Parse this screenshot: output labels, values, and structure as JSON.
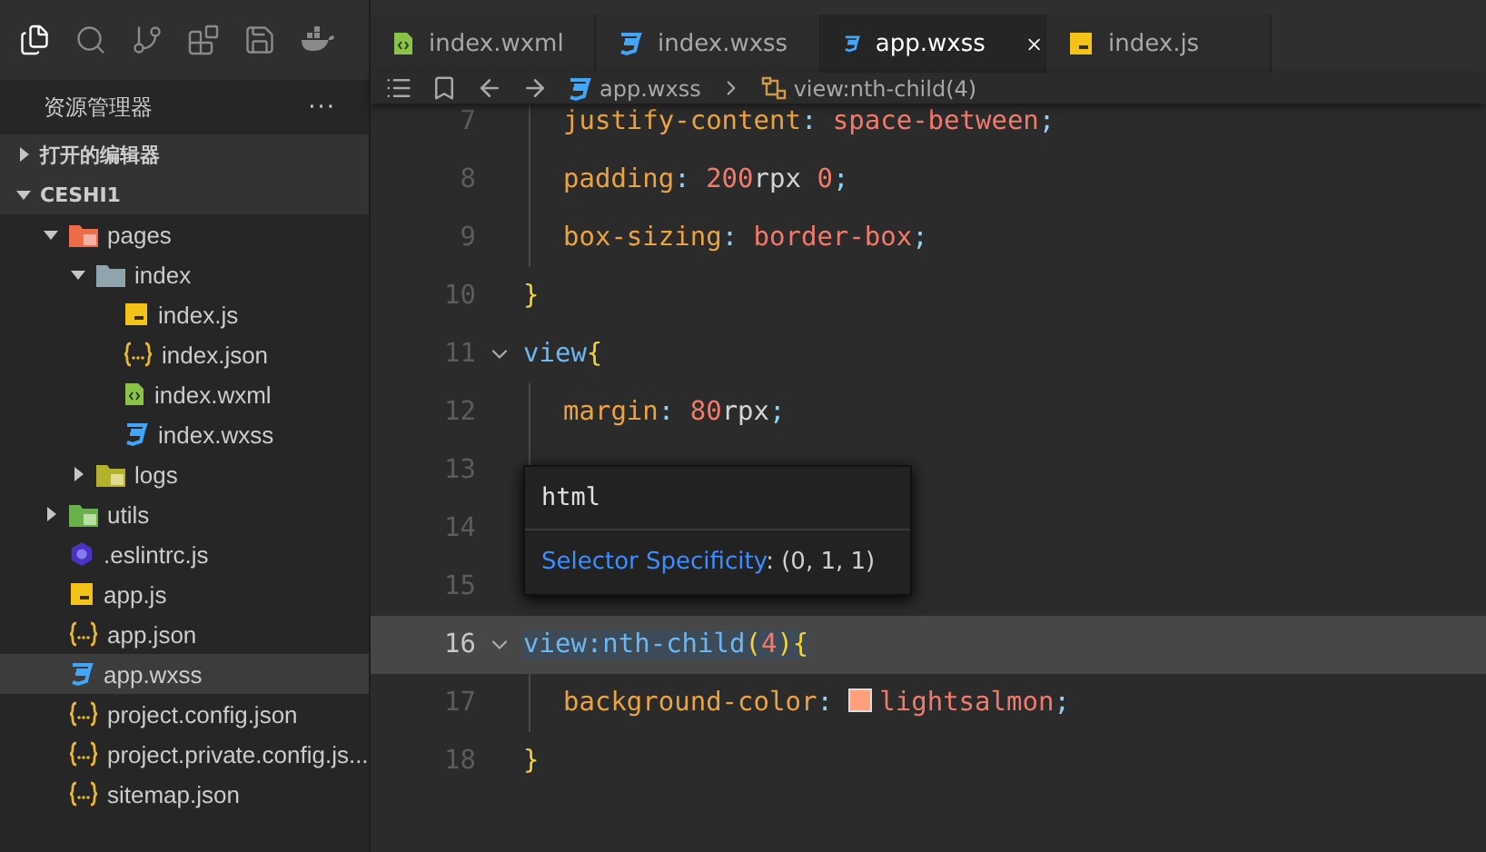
{
  "activity_bar": [
    {
      "kind": "files",
      "selected": true
    },
    {
      "kind": "search",
      "selected": false
    },
    {
      "kind": "branch",
      "selected": false
    },
    {
      "kind": "blocks",
      "selected": false
    },
    {
      "kind": "save",
      "selected": false
    },
    {
      "kind": "whale",
      "selected": false
    }
  ],
  "sidebar": {
    "title": "资源管理器",
    "more": "···",
    "sections": [
      {
        "label": "打开的编辑器",
        "expanded": false
      },
      {
        "label": "CESHI1",
        "expanded": true
      }
    ],
    "tree": [
      {
        "label": "pages",
        "kind": "folder-pages",
        "expanded": true,
        "selected": false,
        "children": [
          {
            "label": "index",
            "kind": "folder",
            "expanded": true,
            "selected": false,
            "children": [
              {
                "label": "index.js",
                "kind": "js",
                "selected": false
              },
              {
                "label": "index.json",
                "kind": "json",
                "selected": false
              },
              {
                "label": "index.wxml",
                "kind": "wxml",
                "selected": false
              },
              {
                "label": "index.wxss",
                "kind": "wxss",
                "selected": false
              }
            ]
          },
          {
            "label": "logs",
            "kind": "folder-logs",
            "expanded": false,
            "selected": false
          }
        ]
      },
      {
        "label": "utils",
        "kind": "folder-utils",
        "expanded": false,
        "selected": false
      },
      {
        "label": ".eslintrc.js",
        "kind": "eslint",
        "selected": false
      },
      {
        "label": "app.js",
        "kind": "js",
        "selected": false
      },
      {
        "label": "app.json",
        "kind": "json",
        "selected": false
      },
      {
        "label": "app.wxss",
        "kind": "wxss",
        "selected": true
      },
      {
        "label": "project.config.json",
        "kind": "json",
        "selected": false
      },
      {
        "label": "project.private.config.js...",
        "kind": "json",
        "selected": false
      },
      {
        "label": "sitemap.json",
        "kind": "json",
        "selected": false
      }
    ]
  },
  "tabs": [
    {
      "label": "index.wxml",
      "kind": "wxml",
      "selected": false
    },
    {
      "label": "index.wxss",
      "kind": "wxss",
      "selected": false
    },
    {
      "label": "app.wxss",
      "kind": "wxss",
      "selected": true
    },
    {
      "label": "index.js",
      "kind": "js",
      "selected": false
    }
  ],
  "breadcrumb": {
    "file": "app.wxss",
    "symbol": "view:nth-child(4)"
  },
  "code_lines": [
    {
      "number": "7",
      "indented": true,
      "foldable": false,
      "current": false,
      "tokens": [
        {
          "kind": "prop",
          "text": "justify-content"
        },
        {
          "kind": "punct",
          "text": ": "
        },
        {
          "kind": "value",
          "text": "space-between"
        },
        {
          "kind": "punct",
          "text": ";"
        }
      ]
    },
    {
      "number": "8",
      "indented": true,
      "foldable": false,
      "current": false,
      "tokens": [
        {
          "kind": "prop",
          "text": "padding"
        },
        {
          "kind": "punct",
          "text": ": "
        },
        {
          "kind": "value",
          "text": "200"
        },
        {
          "kind": "plain",
          "text": "rpx "
        },
        {
          "kind": "value",
          "text": "0"
        },
        {
          "kind": "punct",
          "text": ";"
        }
      ]
    },
    {
      "number": "9",
      "indented": true,
      "foldable": false,
      "current": false,
      "tokens": [
        {
          "kind": "prop",
          "text": "box-sizing"
        },
        {
          "kind": "punct",
          "text": ": "
        },
        {
          "kind": "value",
          "text": "border-box"
        },
        {
          "kind": "punct",
          "text": ";"
        }
      ]
    },
    {
      "number": "10",
      "indented": false,
      "foldable": false,
      "current": false,
      "tokens": [
        {
          "kind": "brace",
          "text": "}"
        }
      ]
    },
    {
      "number": "11",
      "indented": false,
      "foldable": true,
      "current": false,
      "tokens": [
        {
          "kind": "selector",
          "text": "view"
        },
        {
          "kind": "brace",
          "text": "{"
        }
      ]
    },
    {
      "number": "12",
      "indented": true,
      "foldable": false,
      "current": false,
      "tokens": [
        {
          "kind": "prop",
          "text": "margin"
        },
        {
          "kind": "punct",
          "text": ": "
        },
        {
          "kind": "value",
          "text": "80"
        },
        {
          "kind": "plain",
          "text": "rpx"
        },
        {
          "kind": "punct",
          "text": ";"
        }
      ]
    },
    {
      "number": "13",
      "indented": true,
      "foldable": false,
      "current": false
    },
    {
      "number": "14",
      "foldable": false,
      "current": false
    },
    {
      "number": "15",
      "foldable": false,
      "current": false
    },
    {
      "number": "16",
      "indented": false,
      "foldable": true,
      "current": true,
      "tokens": [
        {
          "kind": "selector",
          "text": "view:nth-child"
        },
        {
          "kind": "paren",
          "text": "("
        },
        {
          "kind": "value",
          "text": "4"
        },
        {
          "kind": "paren",
          "text": ")"
        },
        {
          "kind": "brace",
          "text": "{"
        }
      ]
    },
    {
      "number": "17",
      "indented": true,
      "foldable": false,
      "current": false,
      "tokens": [
        {
          "kind": "prop",
          "text": "background-color"
        },
        {
          "kind": "punct",
          "text": ": "
        },
        {
          "kind": "swatch",
          "color": "#ffa07a"
        },
        {
          "kind": "value",
          "text": "lightsalmon"
        },
        {
          "kind": "punct",
          "text": ";"
        }
      ]
    },
    {
      "number": "18",
      "indented": false,
      "foldable": false,
      "current": false,
      "tokens": [
        {
          "kind": "brace",
          "text": "}"
        }
      ]
    }
  ],
  "hover_tooltip": {
    "title": "html",
    "label": "Selector Specificity",
    "value": ": (0, 1, 1)"
  }
}
